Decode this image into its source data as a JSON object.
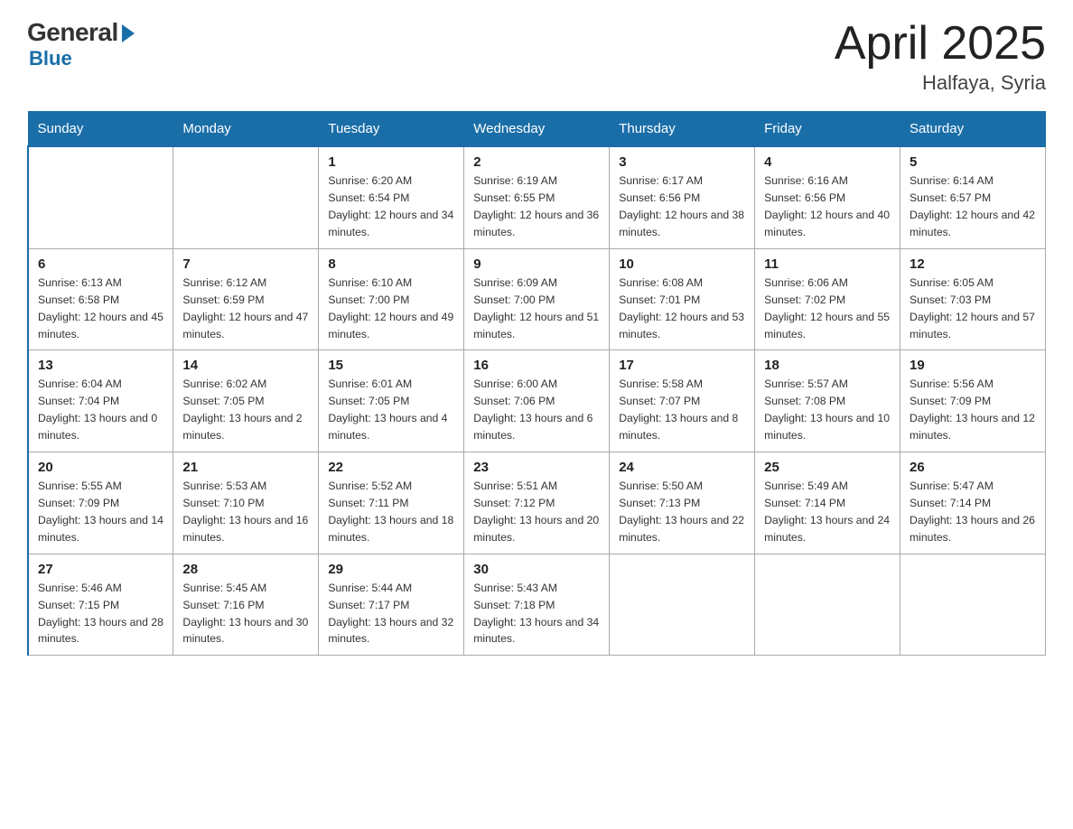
{
  "header": {
    "logo": {
      "general": "General",
      "blue": "Blue"
    },
    "title": "April 2025",
    "location": "Halfaya, Syria"
  },
  "weekdays": [
    "Sunday",
    "Monday",
    "Tuesday",
    "Wednesday",
    "Thursday",
    "Friday",
    "Saturday"
  ],
  "weeks": [
    [
      {
        "day": "",
        "sunrise": "",
        "sunset": "",
        "daylight": ""
      },
      {
        "day": "",
        "sunrise": "",
        "sunset": "",
        "daylight": ""
      },
      {
        "day": "1",
        "sunrise": "Sunrise: 6:20 AM",
        "sunset": "Sunset: 6:54 PM",
        "daylight": "Daylight: 12 hours and 34 minutes."
      },
      {
        "day": "2",
        "sunrise": "Sunrise: 6:19 AM",
        "sunset": "Sunset: 6:55 PM",
        "daylight": "Daylight: 12 hours and 36 minutes."
      },
      {
        "day": "3",
        "sunrise": "Sunrise: 6:17 AM",
        "sunset": "Sunset: 6:56 PM",
        "daylight": "Daylight: 12 hours and 38 minutes."
      },
      {
        "day": "4",
        "sunrise": "Sunrise: 6:16 AM",
        "sunset": "Sunset: 6:56 PM",
        "daylight": "Daylight: 12 hours and 40 minutes."
      },
      {
        "day": "5",
        "sunrise": "Sunrise: 6:14 AM",
        "sunset": "Sunset: 6:57 PM",
        "daylight": "Daylight: 12 hours and 42 minutes."
      }
    ],
    [
      {
        "day": "6",
        "sunrise": "Sunrise: 6:13 AM",
        "sunset": "Sunset: 6:58 PM",
        "daylight": "Daylight: 12 hours and 45 minutes."
      },
      {
        "day": "7",
        "sunrise": "Sunrise: 6:12 AM",
        "sunset": "Sunset: 6:59 PM",
        "daylight": "Daylight: 12 hours and 47 minutes."
      },
      {
        "day": "8",
        "sunrise": "Sunrise: 6:10 AM",
        "sunset": "Sunset: 7:00 PM",
        "daylight": "Daylight: 12 hours and 49 minutes."
      },
      {
        "day": "9",
        "sunrise": "Sunrise: 6:09 AM",
        "sunset": "Sunset: 7:00 PM",
        "daylight": "Daylight: 12 hours and 51 minutes."
      },
      {
        "day": "10",
        "sunrise": "Sunrise: 6:08 AM",
        "sunset": "Sunset: 7:01 PM",
        "daylight": "Daylight: 12 hours and 53 minutes."
      },
      {
        "day": "11",
        "sunrise": "Sunrise: 6:06 AM",
        "sunset": "Sunset: 7:02 PM",
        "daylight": "Daylight: 12 hours and 55 minutes."
      },
      {
        "day": "12",
        "sunrise": "Sunrise: 6:05 AM",
        "sunset": "Sunset: 7:03 PM",
        "daylight": "Daylight: 12 hours and 57 minutes."
      }
    ],
    [
      {
        "day": "13",
        "sunrise": "Sunrise: 6:04 AM",
        "sunset": "Sunset: 7:04 PM",
        "daylight": "Daylight: 13 hours and 0 minutes."
      },
      {
        "day": "14",
        "sunrise": "Sunrise: 6:02 AM",
        "sunset": "Sunset: 7:05 PM",
        "daylight": "Daylight: 13 hours and 2 minutes."
      },
      {
        "day": "15",
        "sunrise": "Sunrise: 6:01 AM",
        "sunset": "Sunset: 7:05 PM",
        "daylight": "Daylight: 13 hours and 4 minutes."
      },
      {
        "day": "16",
        "sunrise": "Sunrise: 6:00 AM",
        "sunset": "Sunset: 7:06 PM",
        "daylight": "Daylight: 13 hours and 6 minutes."
      },
      {
        "day": "17",
        "sunrise": "Sunrise: 5:58 AM",
        "sunset": "Sunset: 7:07 PM",
        "daylight": "Daylight: 13 hours and 8 minutes."
      },
      {
        "day": "18",
        "sunrise": "Sunrise: 5:57 AM",
        "sunset": "Sunset: 7:08 PM",
        "daylight": "Daylight: 13 hours and 10 minutes."
      },
      {
        "day": "19",
        "sunrise": "Sunrise: 5:56 AM",
        "sunset": "Sunset: 7:09 PM",
        "daylight": "Daylight: 13 hours and 12 minutes."
      }
    ],
    [
      {
        "day": "20",
        "sunrise": "Sunrise: 5:55 AM",
        "sunset": "Sunset: 7:09 PM",
        "daylight": "Daylight: 13 hours and 14 minutes."
      },
      {
        "day": "21",
        "sunrise": "Sunrise: 5:53 AM",
        "sunset": "Sunset: 7:10 PM",
        "daylight": "Daylight: 13 hours and 16 minutes."
      },
      {
        "day": "22",
        "sunrise": "Sunrise: 5:52 AM",
        "sunset": "Sunset: 7:11 PM",
        "daylight": "Daylight: 13 hours and 18 minutes."
      },
      {
        "day": "23",
        "sunrise": "Sunrise: 5:51 AM",
        "sunset": "Sunset: 7:12 PM",
        "daylight": "Daylight: 13 hours and 20 minutes."
      },
      {
        "day": "24",
        "sunrise": "Sunrise: 5:50 AM",
        "sunset": "Sunset: 7:13 PM",
        "daylight": "Daylight: 13 hours and 22 minutes."
      },
      {
        "day": "25",
        "sunrise": "Sunrise: 5:49 AM",
        "sunset": "Sunset: 7:14 PM",
        "daylight": "Daylight: 13 hours and 24 minutes."
      },
      {
        "day": "26",
        "sunrise": "Sunrise: 5:47 AM",
        "sunset": "Sunset: 7:14 PM",
        "daylight": "Daylight: 13 hours and 26 minutes."
      }
    ],
    [
      {
        "day": "27",
        "sunrise": "Sunrise: 5:46 AM",
        "sunset": "Sunset: 7:15 PM",
        "daylight": "Daylight: 13 hours and 28 minutes."
      },
      {
        "day": "28",
        "sunrise": "Sunrise: 5:45 AM",
        "sunset": "Sunset: 7:16 PM",
        "daylight": "Daylight: 13 hours and 30 minutes."
      },
      {
        "day": "29",
        "sunrise": "Sunrise: 5:44 AM",
        "sunset": "Sunset: 7:17 PM",
        "daylight": "Daylight: 13 hours and 32 minutes."
      },
      {
        "day": "30",
        "sunrise": "Sunrise: 5:43 AM",
        "sunset": "Sunset: 7:18 PM",
        "daylight": "Daylight: 13 hours and 34 minutes."
      },
      {
        "day": "",
        "sunrise": "",
        "sunset": "",
        "daylight": ""
      },
      {
        "day": "",
        "sunrise": "",
        "sunset": "",
        "daylight": ""
      },
      {
        "day": "",
        "sunrise": "",
        "sunset": "",
        "daylight": ""
      }
    ]
  ]
}
